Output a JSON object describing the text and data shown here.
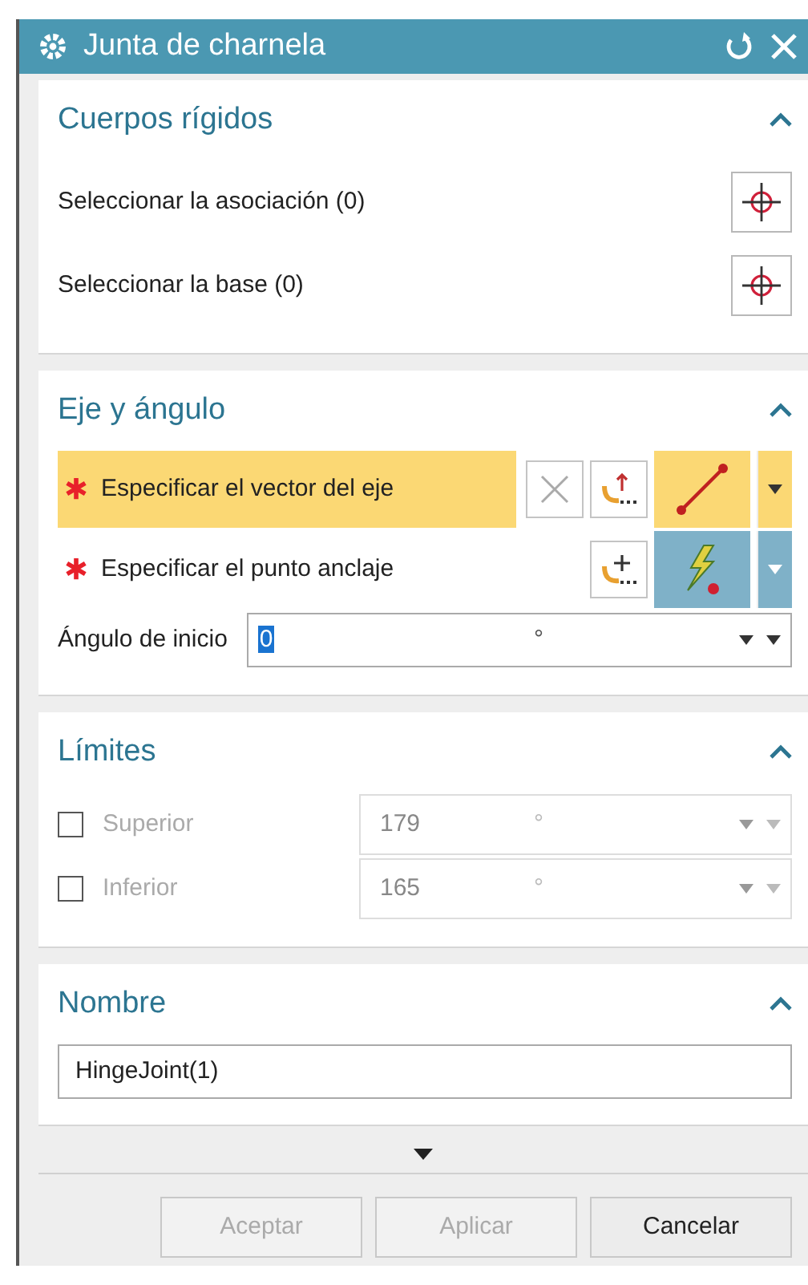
{
  "window": {
    "title": "Junta de charnela"
  },
  "rigid_bodies": {
    "title": "Cuerpos rígidos",
    "expanded": true,
    "rows": [
      {
        "label": "Seleccionar la asociación (0)"
      },
      {
        "label": "Seleccionar la base (0)"
      }
    ]
  },
  "axis_angle": {
    "title": "Eje y ángulo",
    "expanded": true,
    "vector": {
      "label": "Especificar el vector del eje",
      "required": true,
      "highlighted": true,
      "selected": false
    },
    "anchor": {
      "label": "Especificar el punto anclaje",
      "required": true,
      "highlighted": false,
      "selected": true
    },
    "start_angle": {
      "label": "Ángulo de inicio",
      "value": "0",
      "value_selected": true,
      "unit": "°"
    }
  },
  "limits": {
    "title": "Límites",
    "expanded": true,
    "rows": [
      {
        "label": "Superior",
        "checked": false,
        "value": "179",
        "unit": "°"
      },
      {
        "label": "Inferior",
        "checked": false,
        "value": "165",
        "unit": "°"
      }
    ]
  },
  "name": {
    "title": "Nombre",
    "expanded": true,
    "value": "HingeJoint(1)"
  },
  "more": {
    "expanded": false
  },
  "buttons": [
    {
      "label": "Aceptar",
      "disabled": true
    },
    {
      "label": "Aplicar",
      "disabled": true
    },
    {
      "label": "Cancelar",
      "disabled": false
    }
  ]
}
